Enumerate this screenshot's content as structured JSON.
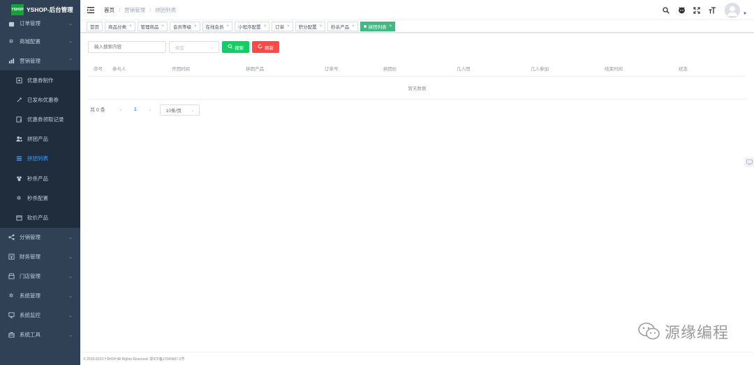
{
  "brand": {
    "logo_text": "YSHOP",
    "title": "YSHOP-后台管理"
  },
  "sidebar": {
    "top_cut_item": "订单管理",
    "before": [
      {
        "label": "商城配置",
        "icon": "gear-icon"
      }
    ],
    "expanded": {
      "label": "营销管理",
      "icon": "chart-icon"
    },
    "sub_items": [
      {
        "label": "优惠券制作",
        "icon": "coupon-icon",
        "active": false
      },
      {
        "label": "已发布优惠券",
        "icon": "tag-icon",
        "active": false
      },
      {
        "label": "优惠券领取记录",
        "icon": "record-icon",
        "active": false
      },
      {
        "label": "拼团产品",
        "icon": "group-icon",
        "active": false
      },
      {
        "label": "拼团列表",
        "icon": "list-icon",
        "active": true
      },
      {
        "label": "秒杀产品",
        "icon": "flash-icon",
        "active": false
      },
      {
        "label": "秒杀配置",
        "icon": "gear-icon",
        "active": false
      },
      {
        "label": "砍价产品",
        "icon": "calendar-icon",
        "active": false
      }
    ],
    "after": [
      {
        "label": "分销管理",
        "icon": "share-icon"
      },
      {
        "label": "财务管理",
        "icon": "finance-icon"
      },
      {
        "label": "门店管理",
        "icon": "store-icon"
      },
      {
        "label": "系统管理",
        "icon": "gear-icon"
      },
      {
        "label": "系统监控",
        "icon": "monitor-icon"
      },
      {
        "label": "系统工具",
        "icon": "toolbox-icon"
      }
    ]
  },
  "breadcrumb": {
    "home": "首页",
    "parent": "营销管理",
    "current": "拼团列表"
  },
  "tags": [
    {
      "label": "首页",
      "closable": false,
      "active": false
    },
    {
      "label": "商品分类",
      "closable": true,
      "active": false
    },
    {
      "label": "管理商品",
      "closable": true,
      "active": false
    },
    {
      "label": "会员等级",
      "closable": true,
      "active": false
    },
    {
      "label": "在线会员",
      "closable": true,
      "active": false
    },
    {
      "label": "小程序配置",
      "closable": true,
      "active": false
    },
    {
      "label": "订单",
      "closable": true,
      "active": false
    },
    {
      "label": "积分配置",
      "closable": true,
      "active": false
    },
    {
      "label": "秒杀产品",
      "closable": true,
      "active": false
    },
    {
      "label": "拼团列表",
      "closable": true,
      "active": true
    }
  ],
  "filter": {
    "search_placeholder": "输入搜索内容",
    "type_placeholder": "类型",
    "search_label": "搜索",
    "refresh_label": "刷新"
  },
  "table": {
    "columns": [
      "序号",
      "参与人",
      "开团时间",
      "拼团产品",
      "订单号",
      "拼团价",
      "几人团",
      "几人参加",
      "结束时间",
      "状态"
    ],
    "empty_text": "暂无数据"
  },
  "pagination": {
    "total": "共 0 条",
    "current": "1",
    "page_size": "10条/页"
  },
  "footer": {
    "text": "© 2018-2023 YSHOP All Rights Reserved. 鄂ICP备17049667-2号"
  },
  "watermark": {
    "text": "源缘编程"
  }
}
